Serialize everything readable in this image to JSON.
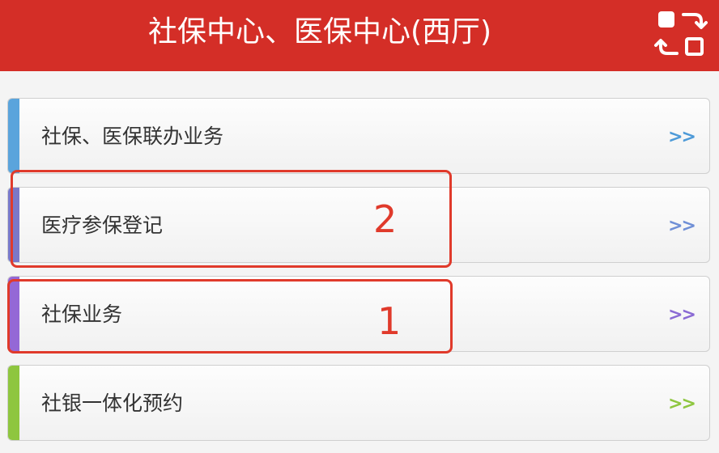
{
  "header": {
    "title": "社保中心、医保中心(西厅)",
    "background": "#d42e27",
    "switch_icon": "switch-layout-icon"
  },
  "menu": {
    "items": [
      {
        "label": "社保、医保联办业务",
        "arrow": ">>",
        "accent": "#5aa4dc",
        "arrow_color": "#4d9ad8"
      },
      {
        "label": "医疗参保登记",
        "arrow": ">>",
        "accent": "#7b78c8",
        "arrow_color": "#6f8fd6"
      },
      {
        "label": "社保业务",
        "arrow": ">>",
        "accent": "#9468d6",
        "arrow_color": "#8a6ad4"
      },
      {
        "label": "社银一体化预约",
        "arrow": ">>",
        "accent": "#8ec63f",
        "arrow_color": "#8ec63f"
      }
    ]
  },
  "annotations": [
    {
      "number": "2",
      "color": "#e03a2b"
    },
    {
      "number": "1",
      "color": "#e03a2b"
    }
  ]
}
